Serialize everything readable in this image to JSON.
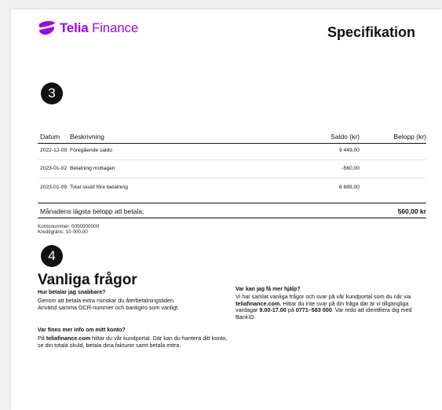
{
  "header": {
    "brand_primary": "Telia",
    "brand_secondary": "Finance",
    "brand_color": "#990ae3",
    "logo_icon": "telia-pebble-icon",
    "title": "Specifikation"
  },
  "steps": {
    "three": "3",
    "four": "4"
  },
  "table": {
    "columns": [
      "Datum",
      "Beskrivning",
      "Saldo (kr)",
      "Belopp (kr)"
    ],
    "rows": [
      {
        "date": "2022-12-09",
        "desc": "Föregående saldo",
        "saldo": "9 449,00",
        "belopp": ""
      },
      {
        "date": "2023-01-02",
        "desc": "Betalning mottagen",
        "saldo": "-560,00",
        "belopp": ""
      },
      {
        "date": "2023-01-09",
        "desc": "Total skuld före betalning",
        "saldo": "8 889,00",
        "belopp": ""
      }
    ],
    "summary_label": "Månadens lägsta belopp att betala:",
    "summary_amount": "560,00 kr"
  },
  "account": {
    "account_number": "Kontonummer: 0000000000",
    "credit_limit": "Kreditgräns: 10 000,00"
  },
  "faq": {
    "title": "Vanliga frågor",
    "q1": "Hur betalar jag snabbare?",
    "a1": "Genom att betala extra minskar du återbetalningstiden. Använd samma OCR-nummer och bankgiro som vanligt.",
    "q2": "Var finns mer info om mitt konto?",
    "a2_pre": "På ",
    "a2_link": "teliafinance.com",
    "a2_post": " hittar du vår kundportal. Där kan du hantera ditt konto, se din totala skuld, betala dina fakturor samt betala extra.",
    "q3": "Var kan jag få mer hjälp?",
    "a3_pre": "Vi har samlat vanliga frågor och svar på vår kundportal som du når via ",
    "a3_link": "teliafinance.com.",
    "a3_mid1": " Hittar du inte svar på din fråga där är vi tillgängliga vardagar ",
    "a3_hours": "9.00-17.00",
    "a3_mid2": " på ",
    "a3_phone": "0771–583 000",
    "a3_post": ". Var redo att identifiera dig med BankID."
  }
}
